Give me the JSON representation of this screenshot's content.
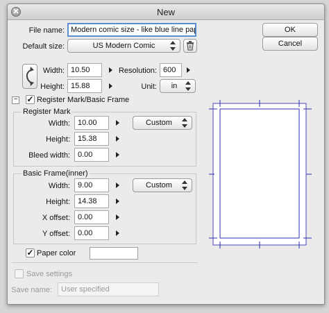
{
  "window": {
    "title": "New",
    "close_glyph": "✕"
  },
  "buttons": {
    "ok": "OK",
    "cancel": "Cancel"
  },
  "file_name": {
    "label": "File name:",
    "value": "Modern comic size - like blue line paper"
  },
  "default_size": {
    "label": "Default size:",
    "value": "US Modern Comic"
  },
  "page": {
    "width_label": "Width:",
    "width_value": "10.50",
    "height_label": "Height:",
    "height_value": "15.88",
    "resolution_label": "Resolution:",
    "resolution_value": "600",
    "unit_label": "Unit:",
    "unit_value": "in"
  },
  "register_frame": {
    "label": "Register Mark/Basic Frame",
    "checked": true,
    "collapse_glyph": "−"
  },
  "register_mark": {
    "title": "Register Mark",
    "width_label": "Width:",
    "width_value": "10.00",
    "height_label": "Height:",
    "height_value": "15.38",
    "bleed_label": "Bleed width:",
    "bleed_value": "0.00",
    "preset": "Custom"
  },
  "basic_frame": {
    "title": "Basic Frame(inner)",
    "width_label": "Width:",
    "width_value": "9.00",
    "height_label": "Height:",
    "height_value": "14.38",
    "xoffset_label": "X offset:",
    "xoffset_value": "0.00",
    "yoffset_label": "Y offset:",
    "yoffset_value": "0.00",
    "preset": "Custom"
  },
  "paper_color": {
    "label": "Paper color",
    "checked": true,
    "swatch": "#ffffff"
  },
  "save_settings": {
    "label": "Save settings",
    "checked": false
  },
  "save_name": {
    "label": "Save name:",
    "value": "User specified"
  },
  "preview": {
    "frame_color": "#2b2bb3"
  },
  "icons": {
    "trash": "trash-icon",
    "orientation": "rotate-orientation-icon",
    "checkmark": "✓"
  }
}
